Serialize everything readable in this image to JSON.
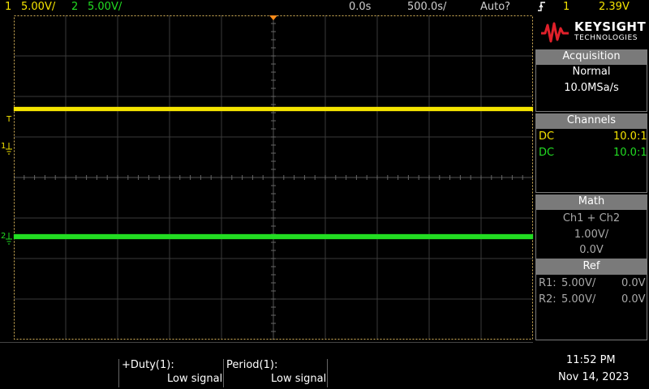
{
  "topbar": {
    "ch1_num": "1",
    "ch1_scale": "5.00V/",
    "ch2_num": "2",
    "ch2_scale": "5.00V/",
    "time_delay": "0.0s",
    "time_scale": "500.0s/",
    "trigger_mode": "Auto?",
    "trigger_slope_icon": "rising-edge-icon",
    "trigger_source": "1",
    "trigger_level": "2.39V"
  },
  "brand": {
    "name": "KEYSIGHT",
    "sub": "TECHNOLOGIES",
    "logo_color": "#e0202a"
  },
  "acquisition": {
    "header": "Acquisition",
    "mode": "Normal",
    "rate": "10.0MSa/s"
  },
  "channels": {
    "header": "Channels",
    "rows": [
      {
        "coupling": "DC",
        "probe": "10.0:1",
        "color": "#f5e400"
      },
      {
        "coupling": "DC",
        "probe": "10.0:1",
        "color": "#22dd22"
      }
    ]
  },
  "math": {
    "header": "Math",
    "expr": "Ch1 + Ch2",
    "scale": "1.00V/",
    "offset": "0.0V"
  },
  "ref": {
    "header": "Ref",
    "rows": [
      {
        "name": "R1:",
        "scale": "5.00V/",
        "offset": "0.0V"
      },
      {
        "name": "R2:",
        "scale": "5.00V/",
        "offset": "0.0V"
      }
    ]
  },
  "markers": {
    "trigger": "T",
    "ch1": "1",
    "ch2": "2"
  },
  "measurements": [
    {
      "label": "+Duty(1):",
      "value": "Low signal"
    },
    {
      "label": "Period(1):",
      "value": "Low signal"
    }
  ],
  "clock": {
    "time": "11:52 PM",
    "date": "Nov 14, 2023"
  },
  "colors": {
    "ch1": "#f5e400",
    "ch2": "#22dd22",
    "grid": "#3a3a3a",
    "border": "#d8b45a",
    "trigger": "#ff8c1a"
  }
}
